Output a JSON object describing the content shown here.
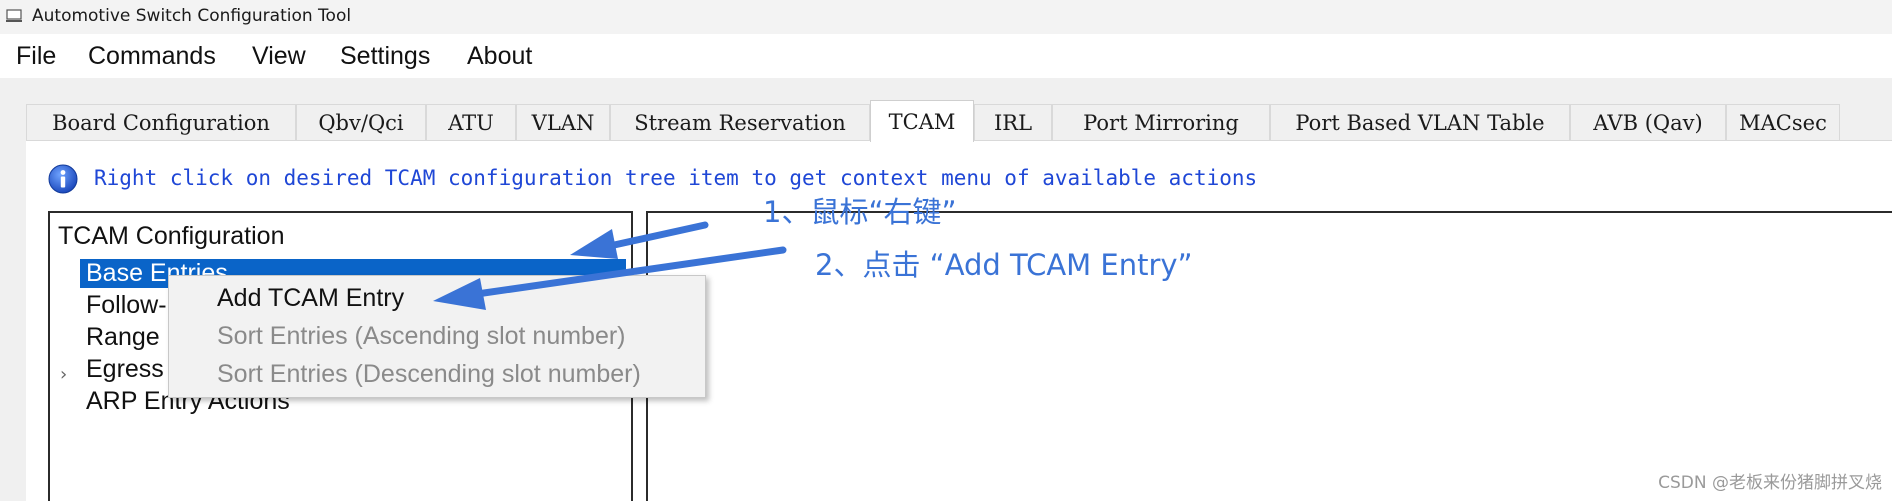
{
  "window": {
    "title": "Automotive Switch Configuration Tool"
  },
  "menu": [
    "File",
    "Commands",
    "View",
    "Settings",
    "About"
  ],
  "tabs": [
    "Board Configuration",
    "Qbv/Qci",
    "ATU",
    "VLAN",
    "Stream Reservation",
    "TCAM",
    "IRL",
    "Port Mirroring",
    "Port Based VLAN Table",
    "AVB (Qav)",
    "MACsec"
  ],
  "active_tab": "TCAM",
  "info_message": "Right click on desired TCAM configuration tree item to get context menu of available actions",
  "tree": {
    "root": "TCAM Configuration",
    "items": [
      "Base Entries",
      "Follow-",
      "Range",
      "Egress",
      "ARP Entry Actions"
    ],
    "selected": "Base Entries"
  },
  "context_menu": {
    "items": [
      {
        "label": "Add TCAM Entry",
        "enabled": true
      },
      {
        "label": "Sort Entries (Ascending slot number)",
        "enabled": false
      },
      {
        "label": "Sort Entries (Descending slot number)",
        "enabled": false
      }
    ]
  },
  "annotations": {
    "step1": "1、鼠标“右键”",
    "step2": "2、点击 “Add TCAM Entry”"
  },
  "watermark": "CSDN @老板来份猪脚拼叉烧",
  "colors": {
    "accent": "#0a64c8",
    "annotation": "#3a73d6",
    "info_text": "#1f47d6"
  }
}
